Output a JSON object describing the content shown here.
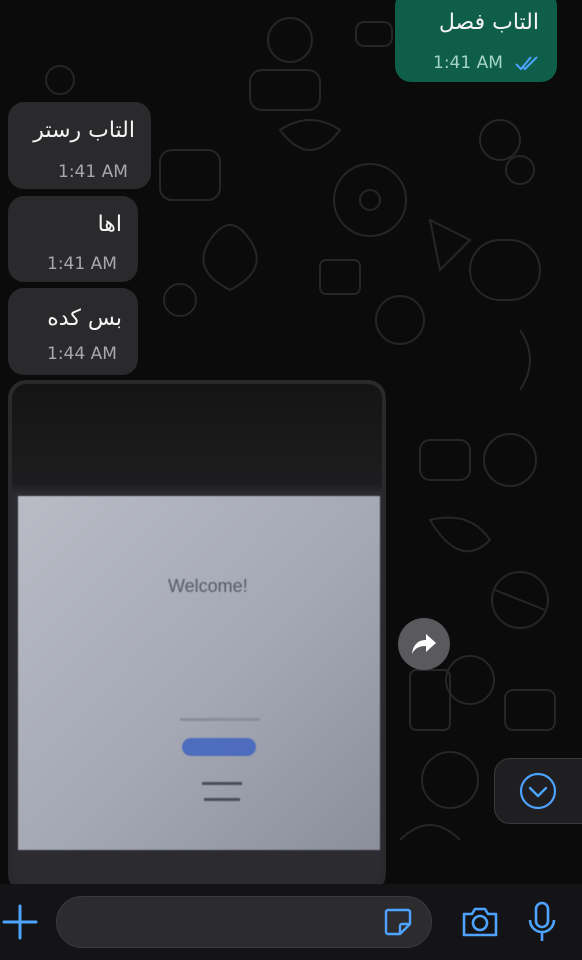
{
  "messages": [
    {
      "text": "التاب فصل",
      "time": "1:41 AM",
      "direction": "outgoing",
      "status": "read-double-check-icon"
    },
    {
      "text": "التاب رستر",
      "time": "1:41 AM",
      "direction": "incoming"
    },
    {
      "text": "اها",
      "time": "1:41 AM",
      "direction": "incoming"
    },
    {
      "text": "بس كده",
      "time": "1:44 AM",
      "direction": "incoming"
    }
  ],
  "photo": {
    "screen_text": "Welcome!"
  },
  "colors": {
    "outgoing_bubble": "#0e5e4a",
    "incoming_bubble": "#2a2a2c",
    "accent_blue": "#4ea3ff",
    "background": "#0b0b0b"
  },
  "icons": [
    "forward-icon",
    "chevron-down-icon",
    "plus-icon",
    "sticker-icon",
    "camera-icon",
    "microphone-icon",
    "read-double-check-icon"
  ]
}
